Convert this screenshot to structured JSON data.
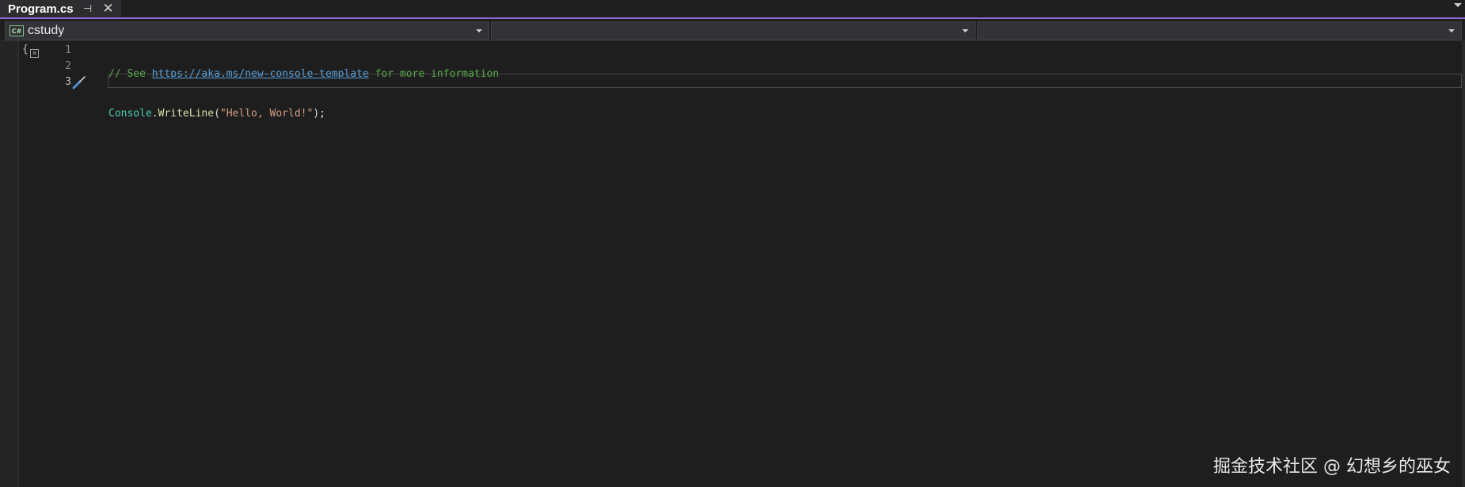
{
  "tab": {
    "title": "Program.cs",
    "pin_glyph": "⊣",
    "close_glyph": "✕"
  },
  "navbar": {
    "project": "cstudy",
    "project_icon": "C#",
    "member": "",
    "scope": ""
  },
  "editor": {
    "line_numbers": [
      "1",
      "2",
      "3"
    ],
    "lines": [
      {
        "comment_prefix": "// See ",
        "link": "https://aka.ms/new-console-template",
        "comment_suffix": " for more information"
      },
      {
        "class_name": "Console",
        "dot": ".",
        "method": "WriteLine",
        "open": "(",
        "string": "\"Hello, World!\"",
        "close": ");"
      },
      {
        "text": ""
      }
    ]
  },
  "icons": [
    "pin-icon",
    "close-icon",
    "csharp-file-icon",
    "chevron-down-icon",
    "fold-brace-icon",
    "quick-actions-screwdriver-icon"
  ],
  "colors": {
    "accent": "#8c6cdb",
    "comment": "#57a64a",
    "link": "#569cd6",
    "type": "#4ec9b0",
    "method": "#dcdcaa",
    "string": "#d69d85"
  },
  "watermark": "掘金技术社区 @ 幻想乡的巫女"
}
